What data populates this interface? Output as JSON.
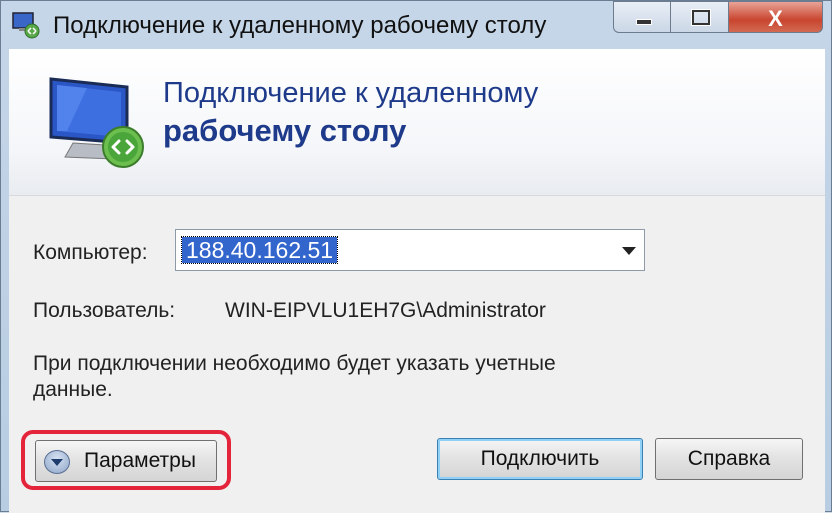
{
  "window": {
    "title": "Подключение к удаленному рабочему столу",
    "close_glyph": "X"
  },
  "banner": {
    "line1": "Подключение к удаленному",
    "line2": "рабочему столу"
  },
  "form": {
    "computer_label": "Компьютер:",
    "computer_value": "188.40.162.51",
    "user_label": "Пользователь:",
    "user_value": "WIN-EIPVLU1EH7G\\Administrator",
    "note_line1": "При подключении необходимо будет указать учетные",
    "note_line2": "данные."
  },
  "buttons": {
    "options": "Параметры",
    "connect": "Подключить",
    "help": "Справка"
  },
  "colors": {
    "heading": "#1e3a8a",
    "selection": "#3366cc",
    "highlight_ring": "#e3243a",
    "close": "#c9452f"
  }
}
